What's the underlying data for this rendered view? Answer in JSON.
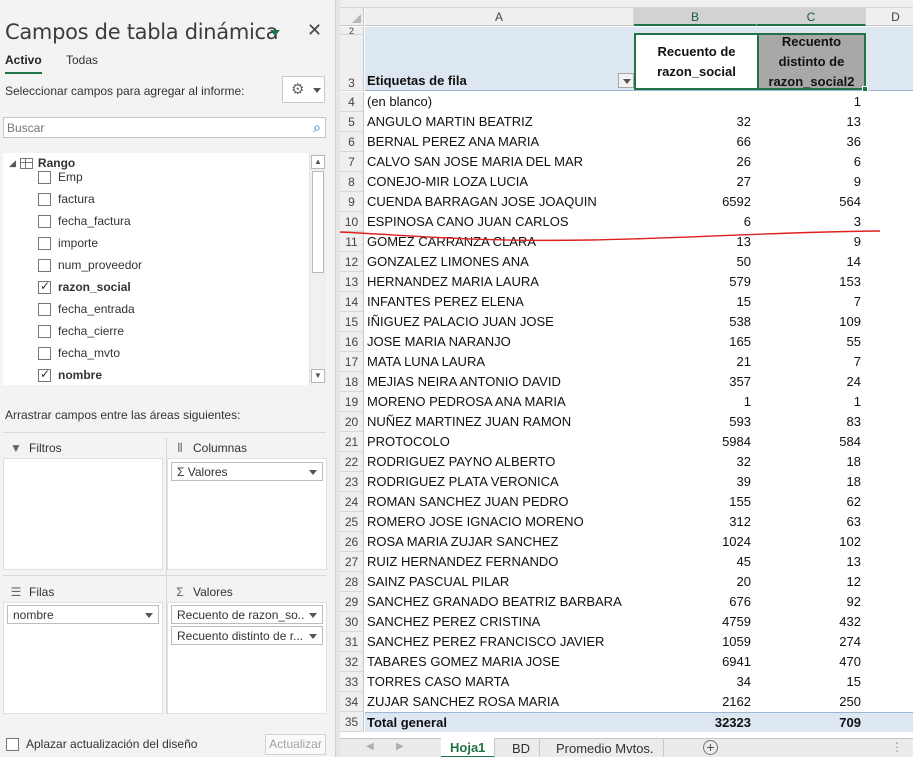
{
  "pane": {
    "title": "Campos de tabla dinámica",
    "tabs": {
      "active": "Activo",
      "all": "Todas"
    },
    "choose_label": "Seleccionar campos para agregar al informe:",
    "search_placeholder": "Buscar",
    "tree_root": "Rango",
    "fields": [
      {
        "label": "Emp",
        "checked": false
      },
      {
        "label": "factura",
        "checked": false
      },
      {
        "label": "fecha_factura",
        "checked": false
      },
      {
        "label": "importe",
        "checked": false
      },
      {
        "label": "num_proveedor",
        "checked": false
      },
      {
        "label": "razon_social",
        "checked": true
      },
      {
        "label": "fecha_entrada",
        "checked": false
      },
      {
        "label": "fecha_cierre",
        "checked": false
      },
      {
        "label": "fecha_mvto",
        "checked": false
      },
      {
        "label": "nombre",
        "checked": true
      }
    ],
    "drag_label": "Arrastrar campos entre las áreas siguientes:",
    "areas": {
      "filters": {
        "title": "Filtros"
      },
      "columns": {
        "title": "Columnas",
        "chips": [
          "Σ  Valores"
        ]
      },
      "rows": {
        "title": "Filas",
        "chips": [
          "nombre"
        ]
      },
      "values": {
        "title": "Valores",
        "chips": [
          "Recuento de razon_so...",
          "Recuento distinto de r..."
        ]
      }
    },
    "defer_label": "Aplazar actualización del diseño",
    "update_button": "Actualizar"
  },
  "sheet": {
    "columns": [
      "A",
      "B",
      "C",
      "D"
    ],
    "top_row_number": "2",
    "header": {
      "row_number": "3",
      "label": "Etiquetas de fila",
      "col_b": "Recuento de razon_social",
      "col_c": "Recuento distinto de razon_social2"
    },
    "rows": [
      {
        "n": "4",
        "name": "(en blanco)",
        "b": "",
        "c": "1"
      },
      {
        "n": "5",
        "name": "ANGULO MARTIN BEATRIZ",
        "b": "32",
        "c": "13"
      },
      {
        "n": "6",
        "name": "BERNAL PEREZ ANA MARIA",
        "b": "66",
        "c": "36"
      },
      {
        "n": "7",
        "name": "CALVO SAN JOSE MARIA DEL MAR",
        "b": "26",
        "c": "6"
      },
      {
        "n": "8",
        "name": "CONEJO-MIR LOZA LUCIA",
        "b": "27",
        "c": "9"
      },
      {
        "n": "9",
        "name": "CUENDA BARRAGAN JOSE JOAQUIN",
        "b": "6592",
        "c": "564"
      },
      {
        "n": "10",
        "name": "ESPINOSA  CANO JUAN CARLOS",
        "b": "6",
        "c": "3"
      },
      {
        "n": "11",
        "name": "GOMEZ CARRANZA CLARA",
        "b": "13",
        "c": "9"
      },
      {
        "n": "12",
        "name": "GONZALEZ LIMONES ANA",
        "b": "50",
        "c": "14"
      },
      {
        "n": "13",
        "name": "HERNANDEZ MARIA LAURA",
        "b": "579",
        "c": "153"
      },
      {
        "n": "14",
        "name": "INFANTES PEREZ ELENA",
        "b": "15",
        "c": "7"
      },
      {
        "n": "15",
        "name": "IÑIGUEZ PALACIO JUAN JOSE",
        "b": "538",
        "c": "109"
      },
      {
        "n": "16",
        "name": "JOSE MARIA NARANJO",
        "b": "165",
        "c": "55"
      },
      {
        "n": "17",
        "name": "MATA LUNA LAURA",
        "b": "21",
        "c": "7"
      },
      {
        "n": "18",
        "name": "MEJIAS NEIRA ANTONIO DAVID",
        "b": "357",
        "c": "24"
      },
      {
        "n": "19",
        "name": "MORENO PEDROSA ANA MARIA",
        "b": "1",
        "c": "1"
      },
      {
        "n": "20",
        "name": "NUÑEZ MARTINEZ JUAN RAMON",
        "b": "593",
        "c": "83"
      },
      {
        "n": "21",
        "name": "PROTOCOLO",
        "b": "5984",
        "c": "584"
      },
      {
        "n": "22",
        "name": "RODRIGUEZ PAYNO ALBERTO",
        "b": "32",
        "c": "18"
      },
      {
        "n": "23",
        "name": "RODRIGUEZ PLATA VERONICA",
        "b": "39",
        "c": "18"
      },
      {
        "n": "24",
        "name": "ROMAN SANCHEZ JUAN PEDRO",
        "b": "155",
        "c": "62"
      },
      {
        "n": "25",
        "name": "ROMERO JOSE IGNACIO MORENO",
        "b": "312",
        "c": "63"
      },
      {
        "n": "26",
        "name": "ROSA MARIA ZUJAR SANCHEZ",
        "b": "1024",
        "c": "102"
      },
      {
        "n": "27",
        "name": "RUIZ HERNANDEZ FERNANDO",
        "b": "45",
        "c": "13"
      },
      {
        "n": "28",
        "name": "SAINZ PASCUAL PILAR",
        "b": "20",
        "c": "12"
      },
      {
        "n": "29",
        "name": "SANCHEZ GRANADO BEATRIZ BARBARA",
        "b": "676",
        "c": "92"
      },
      {
        "n": "30",
        "name": "SANCHEZ PEREZ CRISTINA",
        "b": "4759",
        "c": "432"
      },
      {
        "n": "31",
        "name": "SANCHEZ PEREZ FRANCISCO JAVIER",
        "b": "1059",
        "c": "274"
      },
      {
        "n": "32",
        "name": "TABARES GOMEZ MARIA JOSE",
        "b": "6941",
        "c": "470"
      },
      {
        "n": "33",
        "name": "TORRES CASO MARTA",
        "b": "34",
        "c": "15"
      },
      {
        "n": "34",
        "name": "ZUJAR SANCHEZ ROSA MARIA",
        "b": "2162",
        "c": "250"
      }
    ],
    "total": {
      "n": "35",
      "name": "Total general",
      "b": "32323",
      "c": "709"
    },
    "annotation_color": "#e02020"
  },
  "sheet_tabs": [
    "Hoja1",
    "BD",
    "Promedio Mvtos."
  ],
  "active_sheet_tab": "Hoja1",
  "accent_color": "#217346"
}
